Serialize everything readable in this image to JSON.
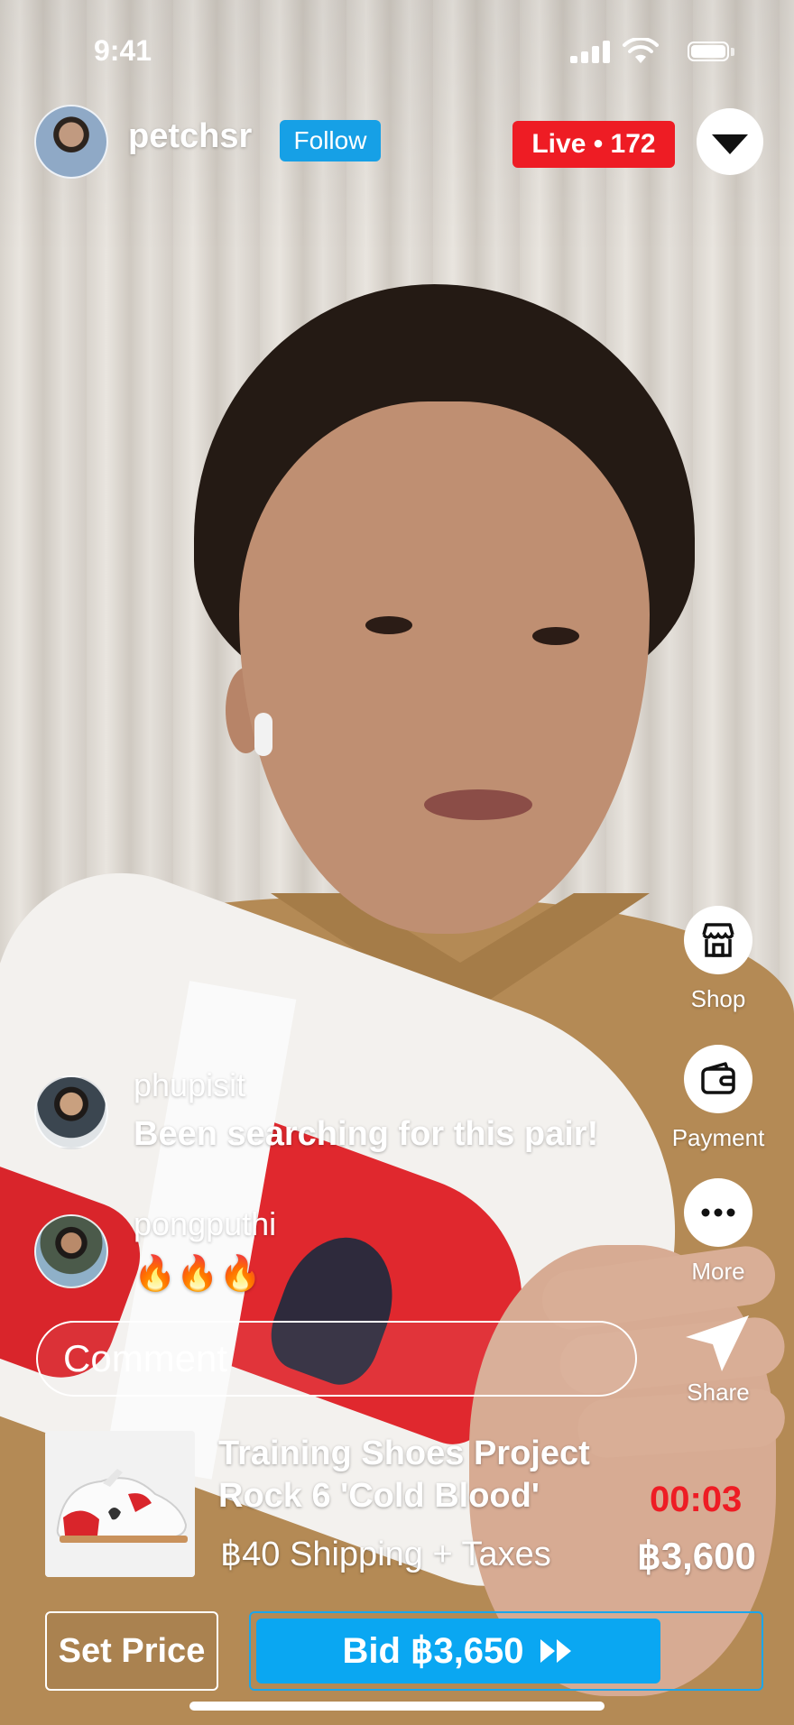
{
  "status_bar": {
    "time": "9:41"
  },
  "host": {
    "username": "petchsr",
    "follow_label": "Follow"
  },
  "live_badge": "Live • 172",
  "side_actions": [
    {
      "label": "Shop",
      "icon": "storefront-icon"
    },
    {
      "label": "Payment",
      "icon": "wallet-icon"
    },
    {
      "label": "More",
      "icon": "ellipsis-icon"
    },
    {
      "label": "Share",
      "icon": "paper-plane-icon"
    }
  ],
  "comments": [
    {
      "user": "phupisit",
      "text": "Been searching for this pair!"
    },
    {
      "user": "pongputhi",
      "text": "🔥🔥🔥"
    }
  ],
  "comment_input": {
    "placeholder": "Comment"
  },
  "product": {
    "name_line1": "Training Shoes Project",
    "name_line2": "Rock 6 'Cold Blood'",
    "shipping": "฿40 Shipping + Taxes",
    "timer": "00:03",
    "current_price": "฿3,600"
  },
  "actions": {
    "set_price_label": "Set Price",
    "bid_label": "Bid ฿3,650"
  },
  "colors": {
    "live_red": "#ee1c24",
    "accent_blue": "#0aa7f2",
    "follow_blue": "#16a0e6"
  }
}
